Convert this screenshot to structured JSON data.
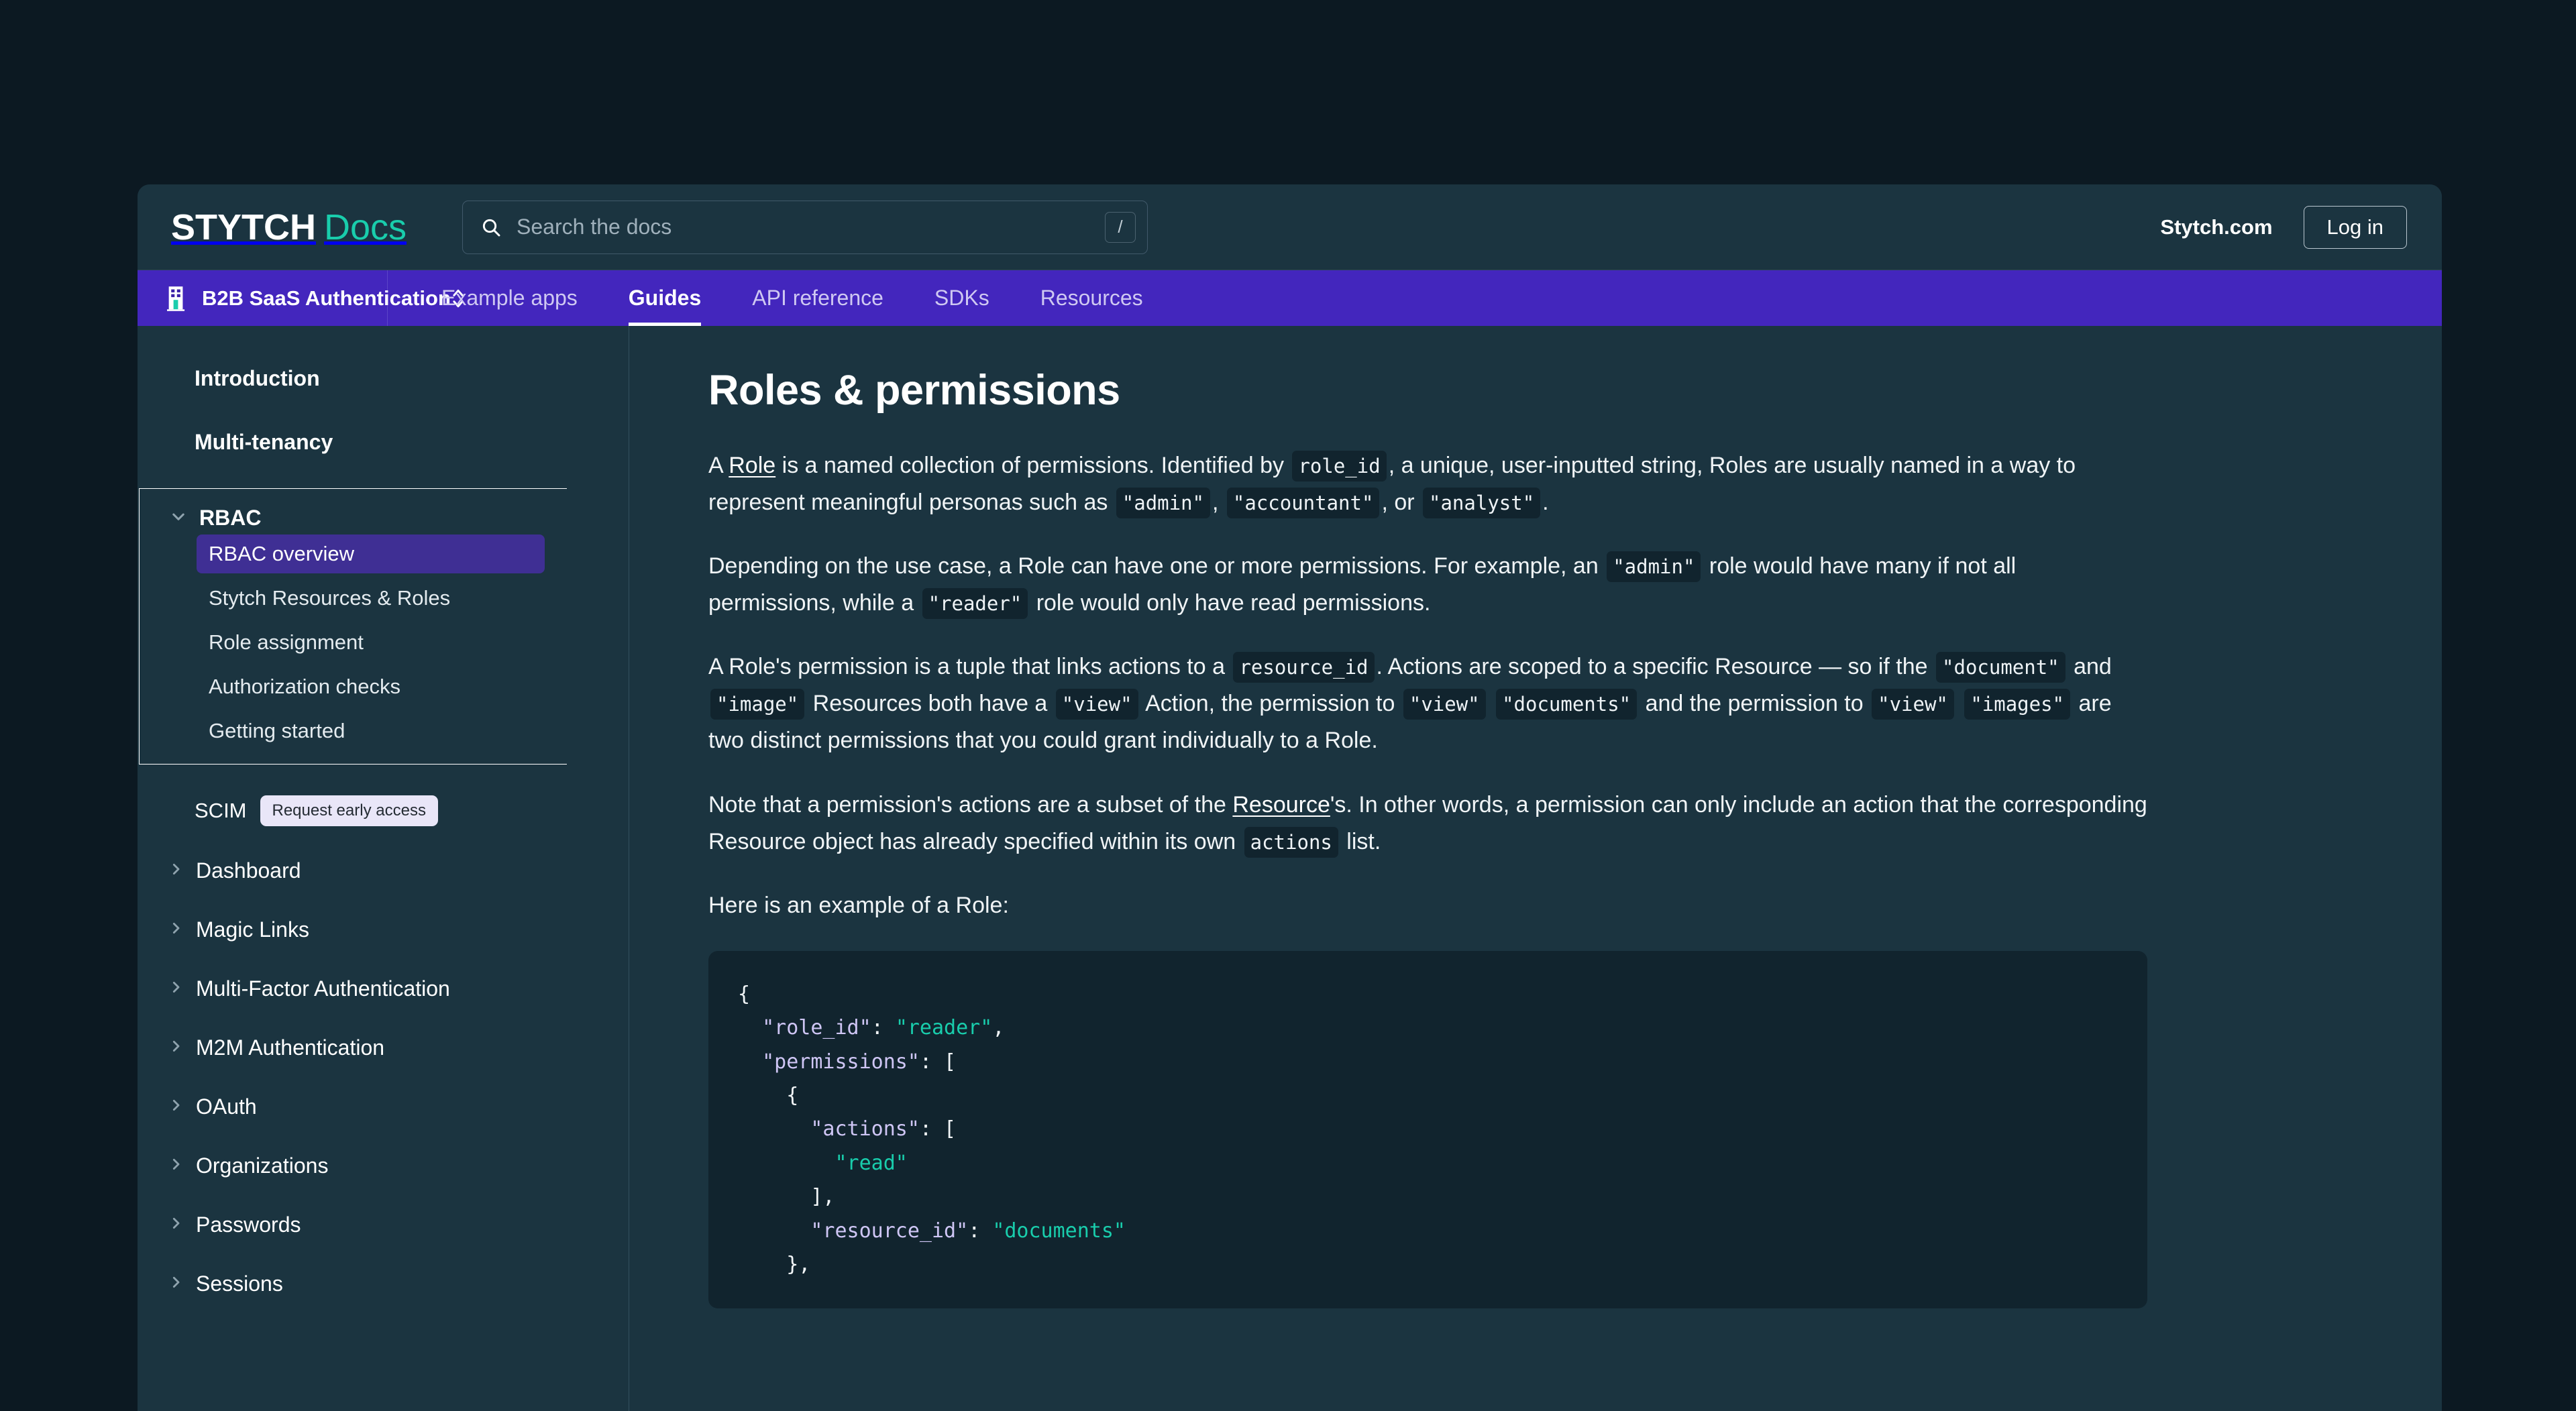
{
  "brand": {
    "primary": "STYTCH",
    "secondary": "Docs"
  },
  "search": {
    "placeholder": "Search the docs",
    "shortcut": "/"
  },
  "header": {
    "site_link": "Stytch.com",
    "login_label": "Log in"
  },
  "product_nav": {
    "product_name": "B2B SaaS Authentication",
    "tabs": [
      {
        "label": "Example apps",
        "active": false
      },
      {
        "label": "Guides",
        "active": true
      },
      {
        "label": "API reference",
        "active": false
      },
      {
        "label": "SDKs",
        "active": false
      },
      {
        "label": "Resources",
        "active": false
      }
    ]
  },
  "sidebar": {
    "top_links": [
      "Introduction",
      "Multi-tenancy"
    ],
    "rbac_group": {
      "label": "RBAC",
      "children": [
        {
          "label": "RBAC overview",
          "current": true
        },
        {
          "label": "Stytch Resources & Roles",
          "current": false
        },
        {
          "label": "Role assignment",
          "current": false
        },
        {
          "label": "Authorization checks",
          "current": false
        },
        {
          "label": "Getting started",
          "current": false
        }
      ]
    },
    "scim": {
      "label": "SCIM",
      "badge": "Request early access"
    },
    "collapsed": [
      "Dashboard",
      "Magic Links",
      "Multi-Factor Authentication",
      "M2M Authentication",
      "OAuth",
      "Organizations",
      "Passwords",
      "Sessions"
    ]
  },
  "main": {
    "title": "Roles & permissions",
    "p1": {
      "a": "A ",
      "link": "Role",
      "b": " is a named collection of permissions. Identified by ",
      "code1": "role_id",
      "c": ", a unique, user-inputted string, Roles are usually named in a way to represent meaningful personas such as ",
      "code2": "\"admin\"",
      "d": ", ",
      "code3": "\"accountant\"",
      "e": ", or ",
      "code4": "\"analyst\"",
      "f": "."
    },
    "p2": {
      "a": "Depending on the use case, a Role can have one or more permissions. For example, an ",
      "code1": "\"admin\"",
      "b": " role would have many if not all permissions, while a ",
      "code2": "\"reader\"",
      "c": " role would only have read permissions."
    },
    "p3": {
      "a": "A Role's permission is a tuple that links actions to a ",
      "code1": "resource_id",
      "b": ". Actions are scoped to a specific Resource — so if the ",
      "code2": "\"document\"",
      "c": " and ",
      "code3": "\"image\"",
      "d": " Resources both have a ",
      "code4": "\"view\"",
      "e": " Action, the permission to ",
      "code5": "\"view\"",
      "f": " ",
      "code6": "\"documents\"",
      "g": " and the permission to ",
      "code7": "\"view\"",
      "h": " ",
      "code8": "\"images\"",
      "i": " are two distinct permissions that you could grant individually to a Role."
    },
    "p4": {
      "a": "Note that a permission's actions are a subset of the ",
      "link": "Resource",
      "b": "'s. In other words, a permission can only include an action that the corresponding Resource object has already specified within its own ",
      "code1": "actions",
      "c": " list."
    },
    "p5": "Here is an example of a Role:",
    "code_block": {
      "lines": [
        [
          {
            "t": "{",
            "c": "pun"
          }
        ],
        [
          {
            "t": "  ",
            "c": "pun"
          },
          {
            "t": "\"role_id\"",
            "c": "key"
          },
          {
            "t": ": ",
            "c": "pun"
          },
          {
            "t": "\"reader\"",
            "c": "str"
          },
          {
            "t": ",",
            "c": "pun"
          }
        ],
        [
          {
            "t": "  ",
            "c": "pun"
          },
          {
            "t": "\"permissions\"",
            "c": "key"
          },
          {
            "t": ": [",
            "c": "pun"
          }
        ],
        [
          {
            "t": "    {",
            "c": "pun"
          }
        ],
        [
          {
            "t": "      ",
            "c": "pun"
          },
          {
            "t": "\"actions\"",
            "c": "key"
          },
          {
            "t": ": [",
            "c": "pun"
          }
        ],
        [
          {
            "t": "        ",
            "c": "pun"
          },
          {
            "t": "\"read\"",
            "c": "str"
          }
        ],
        [
          {
            "t": "      ],",
            "c": "pun"
          }
        ],
        [
          {
            "t": "      ",
            "c": "pun"
          },
          {
            "t": "\"resource_id\"",
            "c": "key"
          },
          {
            "t": ": ",
            "c": "pun"
          },
          {
            "t": "\"documents\"",
            "c": "str"
          }
        ],
        [
          {
            "t": "    },",
            "c": "pun"
          }
        ]
      ]
    }
  },
  "colors": {
    "page_bg": "#1b3440",
    "outer_bg": "#0c1922",
    "nav_purple": "#4326bd",
    "accent_teal": "#19cdac",
    "active_item": "#3f2f94",
    "code_bg": "#11242e"
  }
}
